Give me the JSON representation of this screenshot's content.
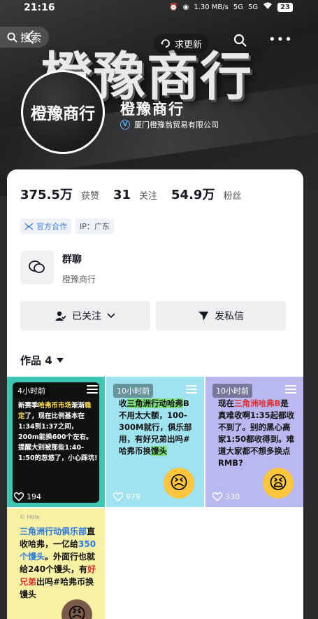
{
  "status_bar": {
    "time": "21:16",
    "net_speed": "1.30 MB/s",
    "signal1": "5G",
    "signal2": "5G",
    "battery": "23"
  },
  "top_nav": {
    "search_label": "搜索",
    "seek_update_label": "求更新"
  },
  "banner": {
    "text": "橙豫商行"
  },
  "profile": {
    "avatar_text": "橙豫商行",
    "name": "橙豫商行",
    "company": "厦门橙豫翁贸易有限公司"
  },
  "stats": {
    "likes_value": "375.5万",
    "likes_label": "获赞",
    "following_value": "31",
    "following_label": "关注",
    "followers_value": "54.9万",
    "followers_label": "粉丝"
  },
  "tags": {
    "official": "官方合作",
    "ip": "IP：广东"
  },
  "group": {
    "title": "群聊",
    "subtitle": "橙豫商行"
  },
  "actions": {
    "followed": "已关注",
    "message": "发私信"
  },
  "works": {
    "label": "作品 4"
  },
  "videos": [
    {
      "time": "4小时前",
      "likes": "194",
      "lines": [
        "新赛季",
        "哈弗币市场",
        "渐渐",
        "稳定",
        "了，现在比例基本在1:34到1:37之间，200m能换600个左右。提醒大别被那些1:40-1:50的忽悠了，小心踩坑!"
      ]
    },
    {
      "time": "10小时前",
      "likes": "979",
      "text_a": "收",
      "text_hl": "三角洲行动哈弗",
      "text_b": "B不用太大额，100-300M就行，俱乐部用，有好兄弟出吗#哈弗币换",
      "text_hl2": "馒头"
    },
    {
      "time": "10小时前",
      "likes": "330",
      "text_a": "现在",
      "text_hl": "三角洲哈弗B",
      "text_b": "是真难收啊1:35起都收不到了。别的黑心高家1:50都收得到。难道大家都不想多换点RMB?"
    },
    {
      "logo": "© Hdle",
      "text_hl": "三角洲行动俱乐部",
      "text_a": "直收哈弗，一亿给",
      "text_hl2": "350个馒头",
      "text_b": "。外面行也就给240个馒头，有",
      "text_hl3": "好兄弟",
      "text_c": "出吗#哈弗币换馒头"
    }
  ],
  "colors": {
    "accent_blue": "#3f7fd9",
    "text_dark": "#161823"
  }
}
